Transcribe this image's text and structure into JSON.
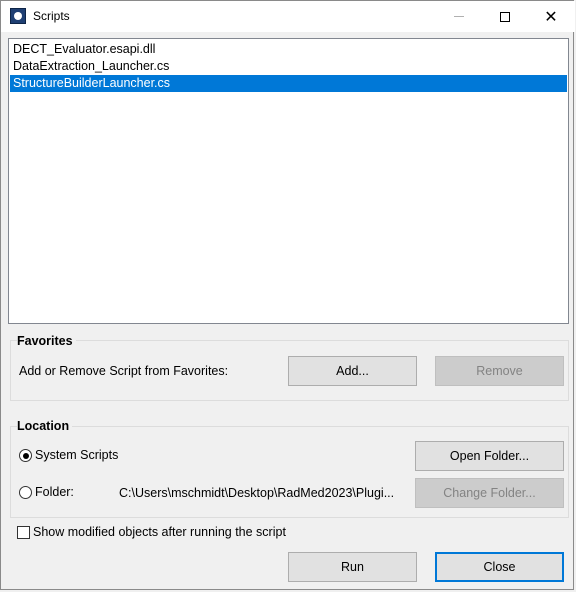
{
  "window": {
    "title": "Scripts",
    "icon": "app-logo-icon",
    "controls": {
      "minimize": "minimize-icon",
      "maximize": "maximize-icon",
      "close": "✕"
    }
  },
  "scripts": {
    "items": [
      {
        "label": "DECT_Evaluator.esapi.dll",
        "selected": false
      },
      {
        "label": "DataExtraction_Launcher.cs",
        "selected": false
      },
      {
        "label": "StructureBuilderLauncher.cs",
        "selected": true
      }
    ]
  },
  "favorites": {
    "heading": "Favorites",
    "prompt": "Add or Remove Script from Favorites:",
    "add_label": "Add...",
    "remove_label": "Remove"
  },
  "location": {
    "heading": "Location",
    "system_scripts_label": "System Scripts",
    "system_scripts_selected": true,
    "folder_label": "Folder:",
    "folder_path": "C:\\Users\\mschmidt\\Desktop\\RadMed2023\\Plugi...",
    "open_folder_label": "Open Folder...",
    "change_folder_label": "Change Folder..."
  },
  "options": {
    "show_modified_label": "Show modified objects after running the script",
    "show_modified_checked": false
  },
  "actions": {
    "run_label": "Run",
    "close_label": "Close"
  },
  "colors": {
    "selection": "#0078d7",
    "disabled_text": "#838383"
  }
}
